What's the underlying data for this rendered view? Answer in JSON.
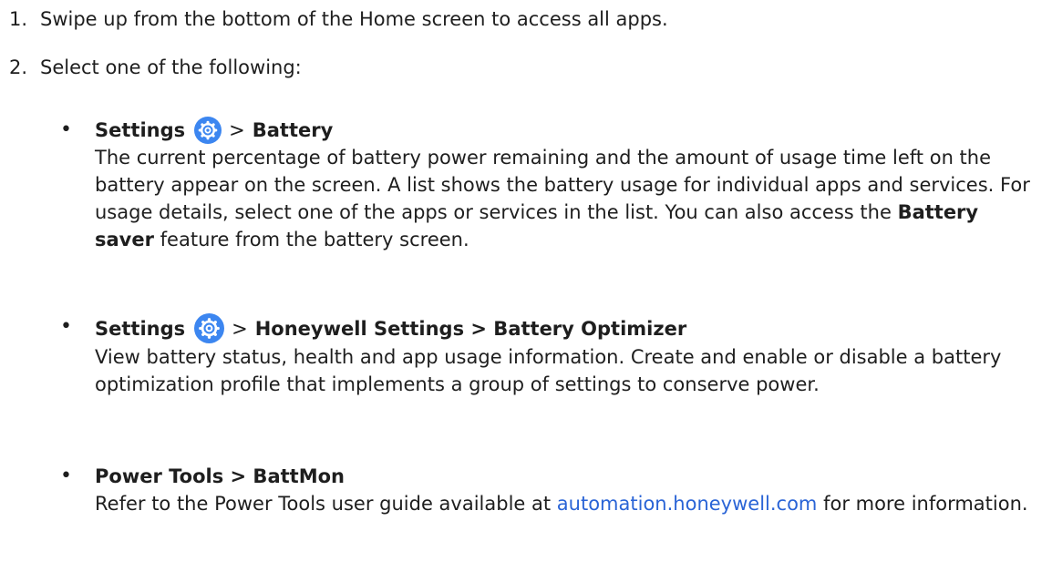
{
  "steps": [
    {
      "num": "1.",
      "text": "Swipe up from the bottom of the Home screen to access all apps."
    },
    {
      "num": "2.",
      "text": "Select one of the following:"
    }
  ],
  "bullet_glyph": "•",
  "separator": ">",
  "items": [
    {
      "heading_start": "Settings",
      "icon": "settings-gear-icon",
      "heading_rest": "Battery",
      "para": {
        "part1": "The current percentage of battery power remaining and the amount of usage time left on the battery appear on the screen. A list shows the battery usage for individual apps and services. For usage details, select one of the apps or services in the list. You can also access the",
        "bold": "Battery saver",
        "part2": "feature from the battery screen."
      }
    },
    {
      "heading_start": "Settings",
      "icon": "settings-gear-icon",
      "heading_rest": "Honeywell Settings > Battery Optimizer",
      "para": "View battery status, health and app usage information. Create and enable or disable a battery optimization profile that implements a group of settings to conserve power."
    },
    {
      "heading": "Power Tools > BattMon",
      "para": {
        "part1": "Refer to the Power Tools user guide available at",
        "link": "automation.honeywell.com",
        "part2": "for more information."
      }
    }
  ],
  "colors": {
    "icon": "#3c86f0",
    "link": "#2a64d6",
    "text": "#1e1e1e"
  }
}
